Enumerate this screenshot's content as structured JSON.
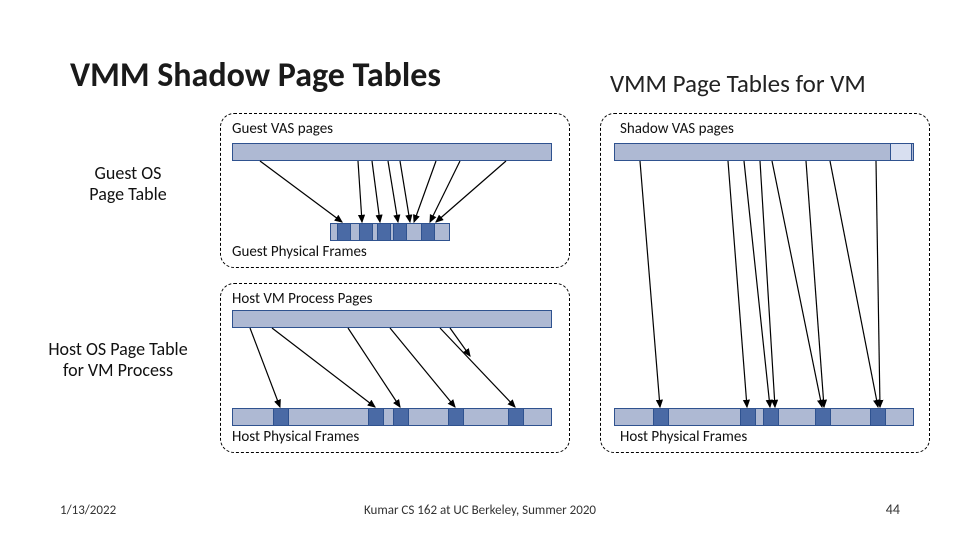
{
  "title": "VMM Shadow Page Tables",
  "subtitle": "VMM Page Tables for VM",
  "labels": {
    "guest_os_pt": "Guest OS\nPage Table",
    "host_os_pt": "Host OS Page Table\nfor VM Process",
    "guest_vas": "Guest VAS pages",
    "guest_phys": "Guest Physical Frames",
    "host_vm_pages": "Host VM Process Pages",
    "host_phys_left": "Host Physical Frames",
    "shadow_vas": "Shadow VAS pages",
    "host_phys_right": "Host Physical Frames"
  },
  "footer": {
    "date": "1/13/2022",
    "center": "Kumar CS 162 at UC Berkeley, Summer 2020",
    "page": "44"
  }
}
